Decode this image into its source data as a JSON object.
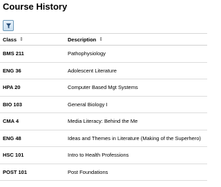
{
  "page": {
    "title": "Course History"
  },
  "toolbar": {
    "filter_icon": "filter-icon"
  },
  "table": {
    "columns": [
      {
        "label": "Class",
        "sort_icon": "sort-icon"
      },
      {
        "label": "Description",
        "sort_icon": "sort-icon"
      }
    ],
    "rows": [
      {
        "class": "BMS 211",
        "description": "Pathophysiology"
      },
      {
        "class": "ENG 36",
        "description": "Adolescent Literature"
      },
      {
        "class": "HPA 20",
        "description": "Computer Based Mgt Systems"
      },
      {
        "class": "BIO 103",
        "description": "General Biology I"
      },
      {
        "class": "CMA 4",
        "description": "Media  Literacy: Behind the Me"
      },
      {
        "class": "ENG 48",
        "description": "Ideas and Themes in Literature (Making of the Superhero)"
      },
      {
        "class": "HSC 101",
        "description": "Intro to Health Professions"
      },
      {
        "class": "POST 101",
        "description": "Post Foundations"
      }
    ]
  }
}
